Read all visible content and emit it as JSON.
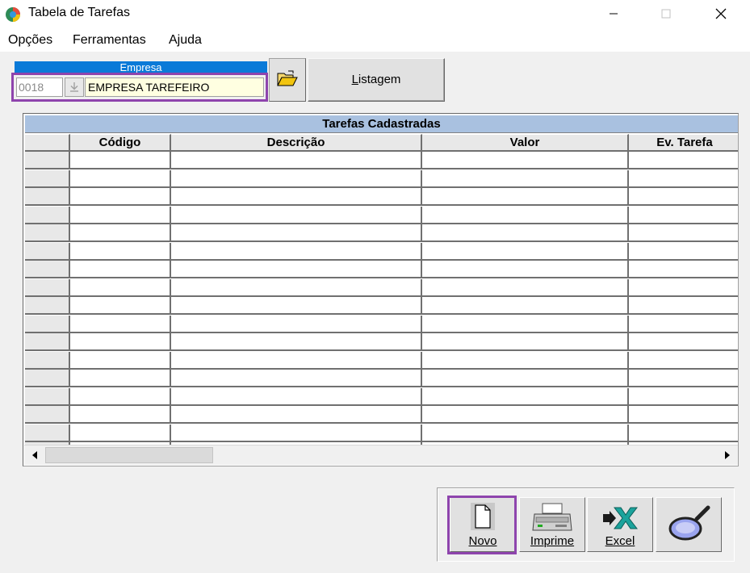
{
  "window": {
    "title": "Tabela de Tarefas"
  },
  "menu": [
    {
      "label": "Opções"
    },
    {
      "label": "Ferramentas"
    },
    {
      "label": "Ajuda"
    }
  ],
  "empresa": {
    "header": "Empresa",
    "code": "0018",
    "name": "EMPRESA TAREFEIRO"
  },
  "buttons": {
    "listagem": "Listagem",
    "novo": "Novo",
    "imprime": "Imprime",
    "excel": "Excel"
  },
  "grid": {
    "caption": "Tarefas Cadastradas",
    "columns": [
      "Código",
      "Descrição",
      "Valor",
      "Ev. Tarefa"
    ],
    "rows": []
  },
  "icons": {
    "app": "app-globe-icon",
    "folder": "folder-open-icon",
    "novo": "new-document-icon",
    "imprime": "printer-icon",
    "excel": "excel-icon",
    "search": "magnifier-icon"
  },
  "colors": {
    "empresa_header": "#0a7ad8",
    "grid_caption": "#a9c1e0",
    "highlight": "#8e44ad",
    "empresa_field": "#ffffe1"
  }
}
